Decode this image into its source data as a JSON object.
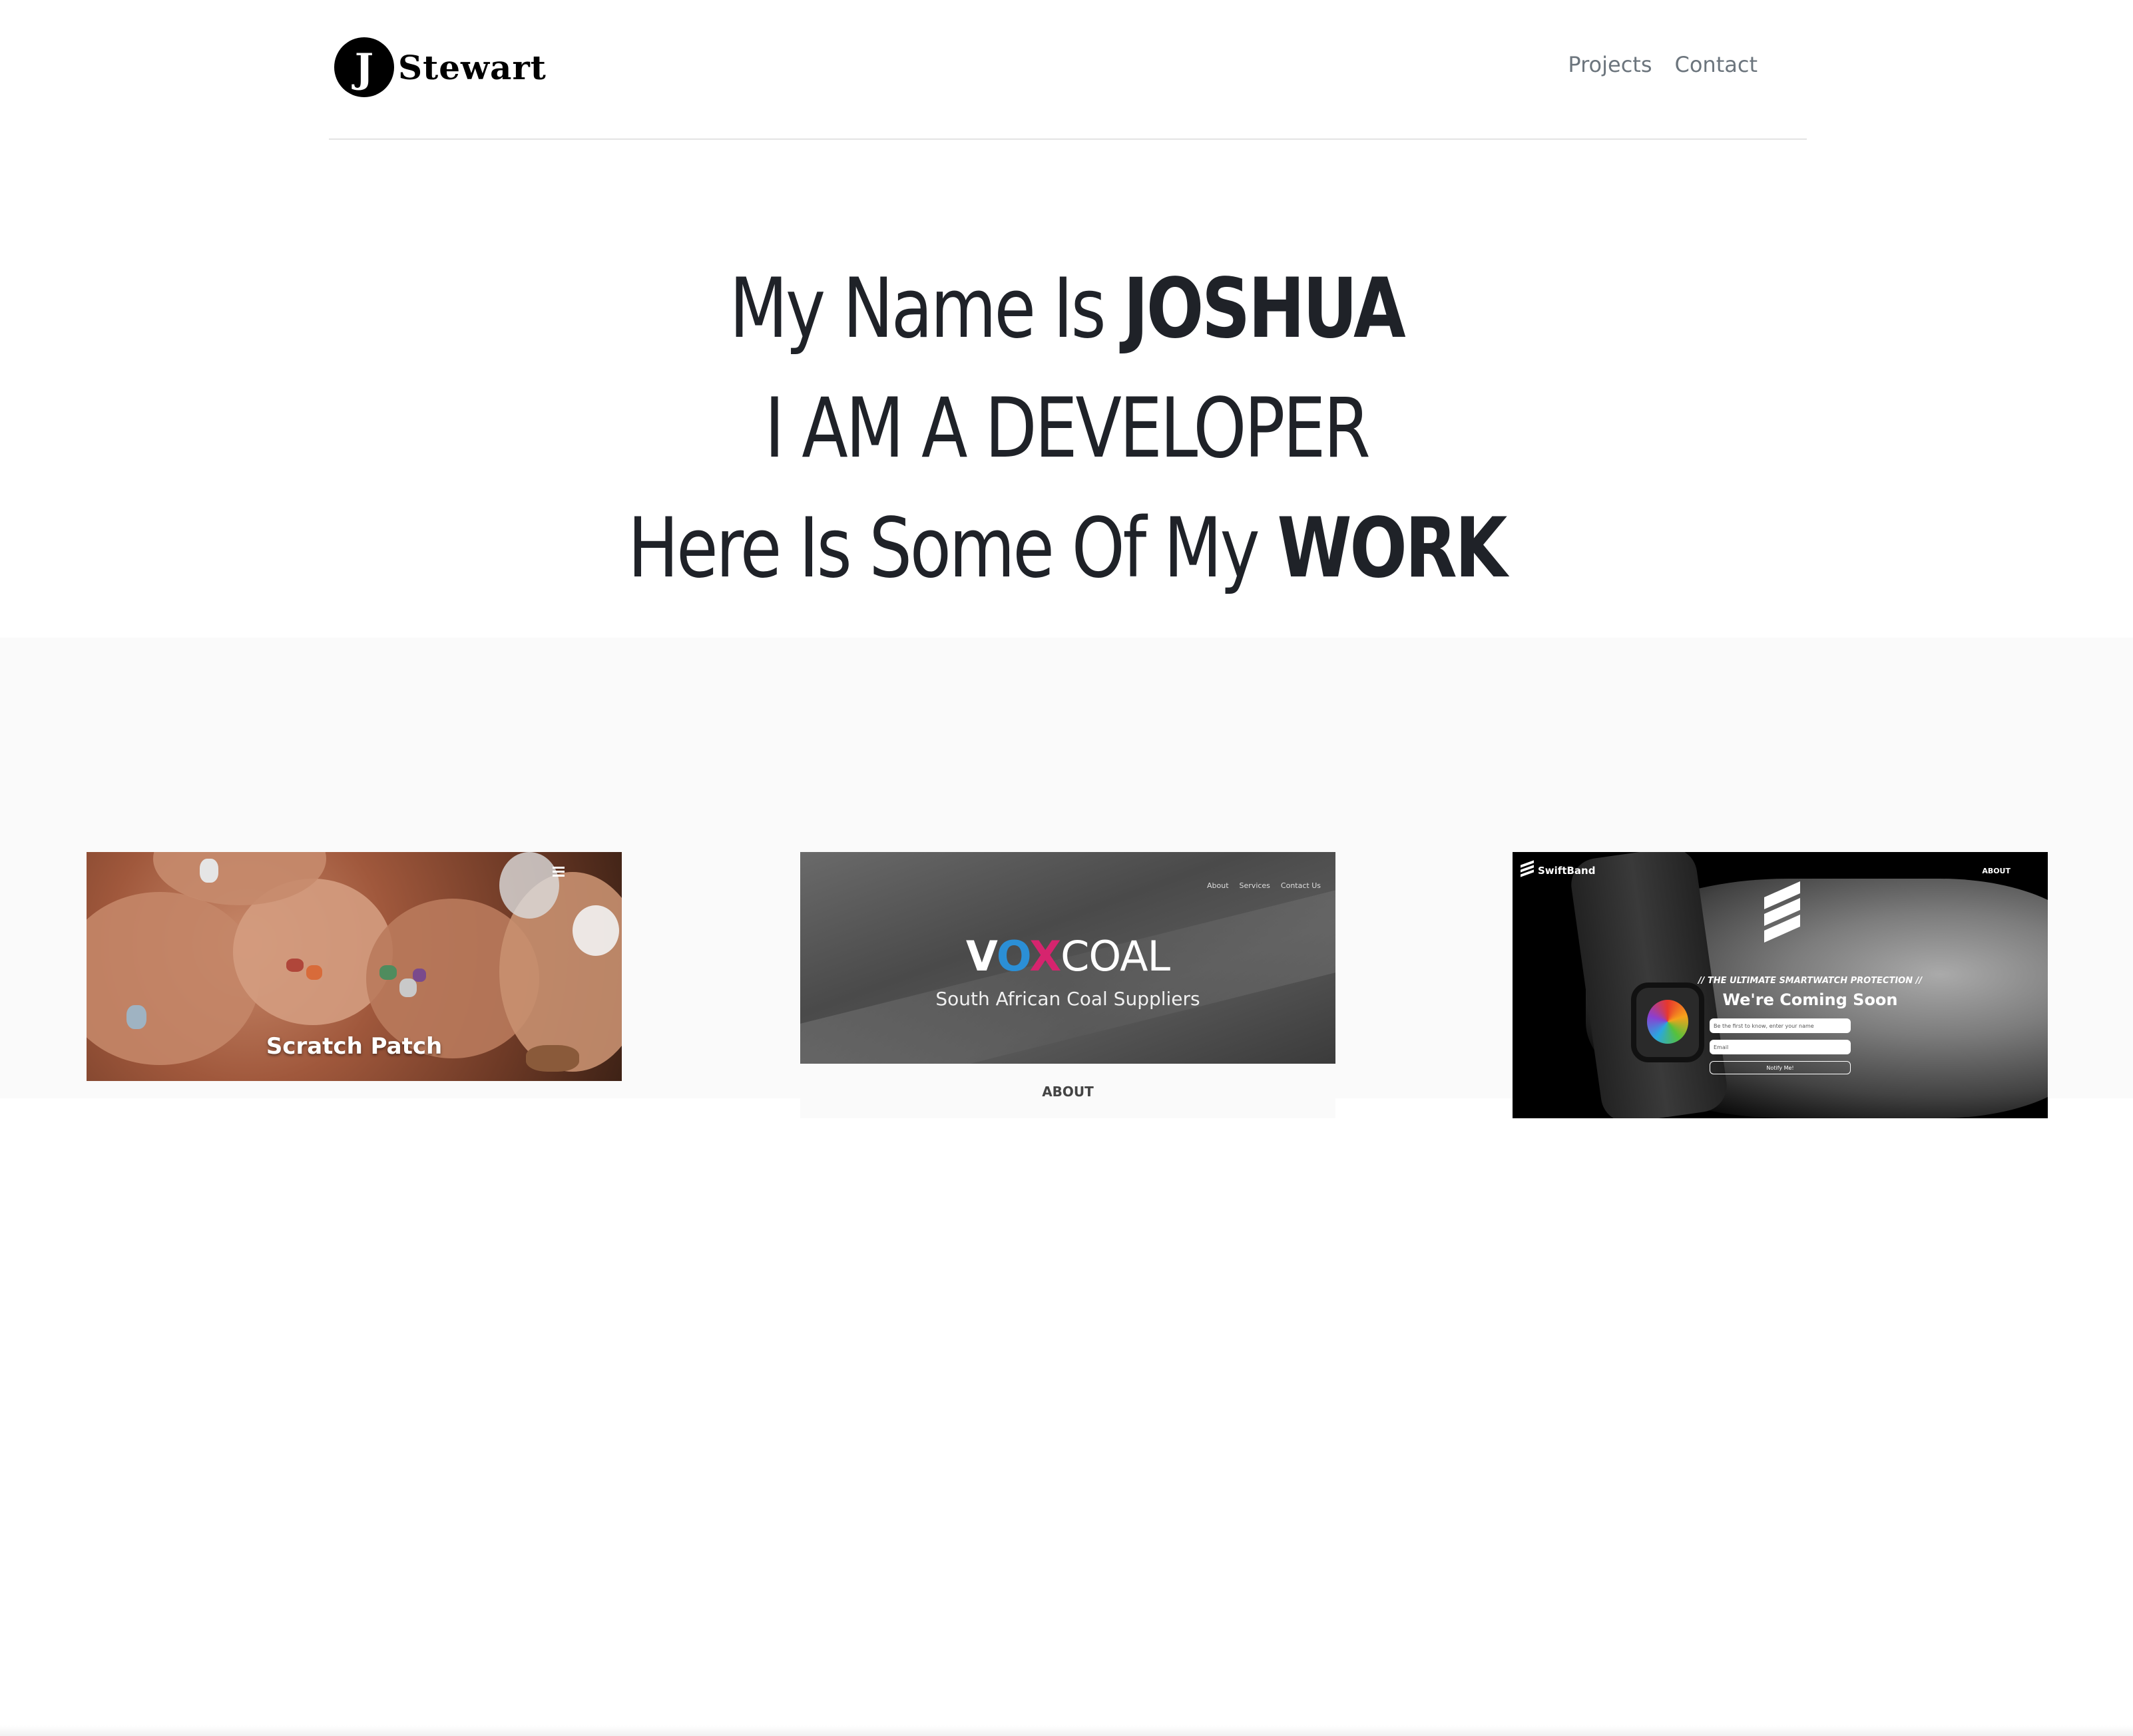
{
  "header": {
    "logo_letter": "J",
    "logo_text": "Stewart",
    "nav": [
      {
        "label": "Projects"
      },
      {
        "label": "Contact"
      }
    ]
  },
  "hero": {
    "line1_regular": "My Name Is ",
    "line1_bold": "JOSHUA",
    "line2": "I AM A DEVELOPER",
    "line3_regular": "Here Is Some Of My ",
    "line3_bold": "WORK"
  },
  "projects": [
    {
      "title": "Scratch Patch"
    },
    {
      "logo_v": "V",
      "logo_o": "O",
      "logo_x": "X",
      "logo_rest": "COAL",
      "subtitle": "South African Coal Suppliers",
      "nav": [
        "About",
        "Services",
        "Contact Us"
      ],
      "section_label": "ABOUT"
    },
    {
      "brand": "SwiftBand",
      "nav_about": "ABOUT",
      "tagline": "// THE ULTIMATE SMARTWATCH PROTECTION //",
      "headline": "We're Coming Soon",
      "name_placeholder": "Be the first to know, enter your name",
      "email_placeholder": "Email",
      "notify_label": "Notify Me!"
    }
  ]
}
